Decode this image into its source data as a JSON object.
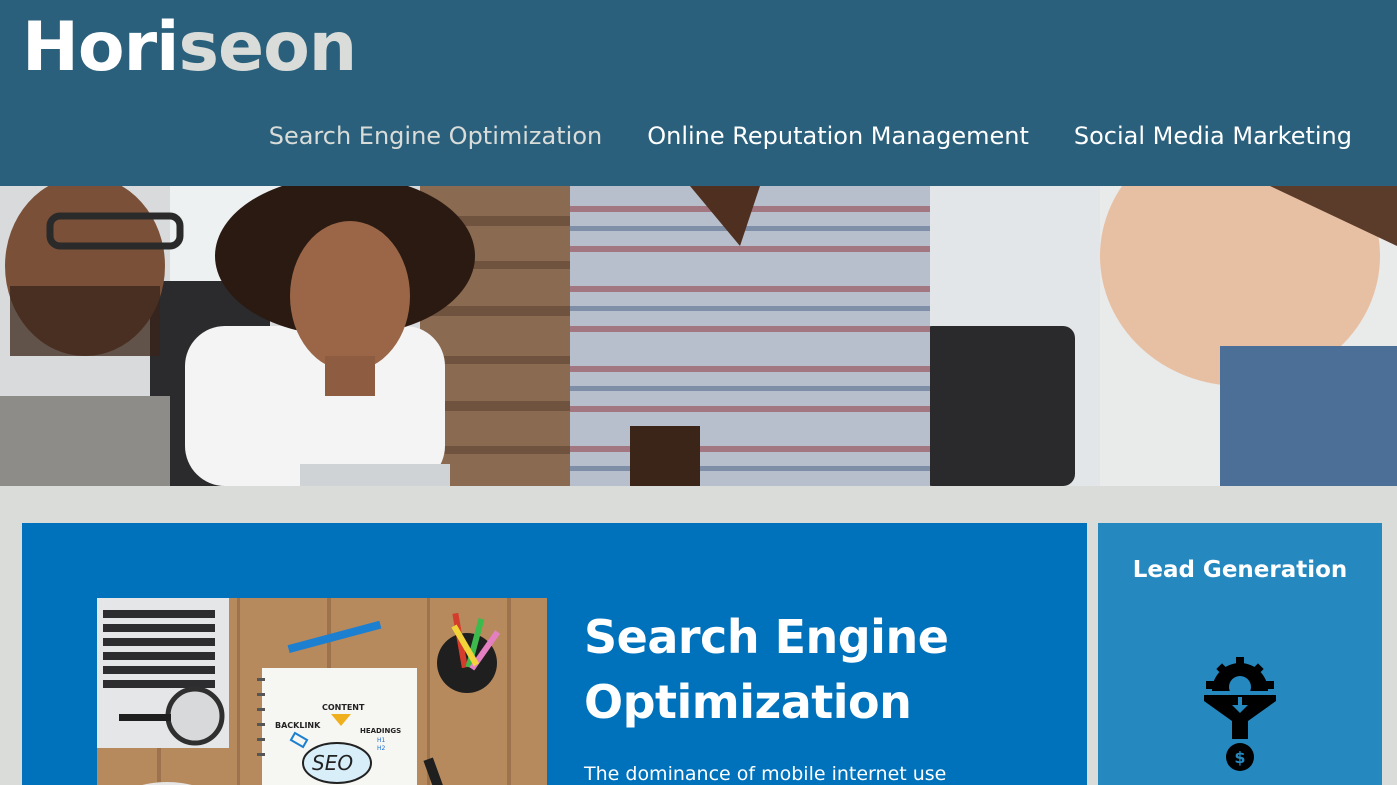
{
  "header": {
    "logo_part1": "Hori",
    "logo_part2": "seon",
    "nav": [
      {
        "label": "Search Engine Optimization"
      },
      {
        "label": "Online Reputation Management"
      },
      {
        "label": "Social Media Marketing"
      }
    ]
  },
  "hero": {
    "icon": "team-meeting-photo"
  },
  "main_card": {
    "title_line1": "Search Engine",
    "title_line2": "Optimization",
    "text": "The dominance of mobile internet use",
    "image_labels": {
      "content": "CONTENT",
      "backlink": "BACKLINK",
      "headings": "HEADINGS",
      "h1": "H1",
      "h2": "H2",
      "seo": "SEO"
    }
  },
  "side_card": {
    "title": "Lead Generation",
    "icon": "lead-generation-funnel-icon"
  },
  "colors": {
    "header": "#2a607c",
    "page_bg": "#d9dcd9",
    "card_bg": "#0072bb",
    "side_bg": "#2588bf"
  }
}
